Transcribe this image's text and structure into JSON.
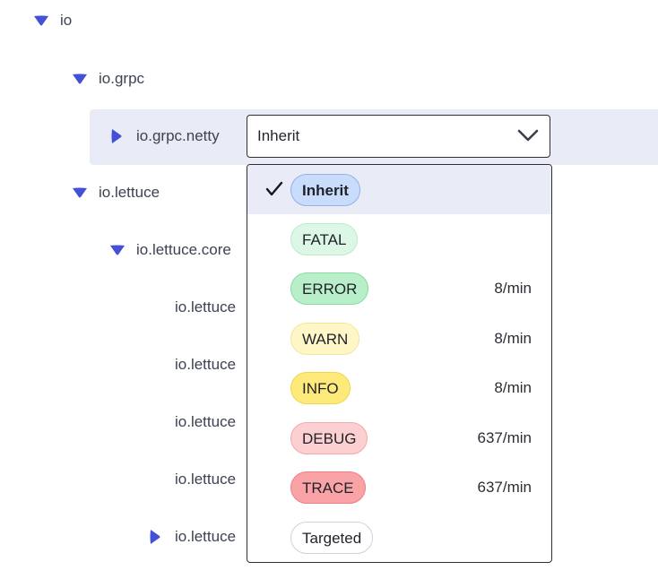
{
  "tree": [
    {
      "label": "io",
      "expander": "expanded-triangle-icon"
    },
    {
      "label": "io.grpc",
      "expander": "expanded-triangle-icon"
    },
    {
      "label": "io.grpc.netty",
      "expander": "collapsed-triangle-icon"
    },
    {
      "label": "io.lettuce",
      "expander": "expanded-triangle-icon"
    },
    {
      "label": "io.lettuce.core",
      "expander": "expanded-triangle-icon"
    },
    {
      "label": "io.lettuce",
      "expander": null
    },
    {
      "label": "io.lettuce",
      "expander": null
    },
    {
      "label": "io.lettuce",
      "expander": null
    },
    {
      "label": "io.lettuce",
      "expander": null
    },
    {
      "label": "io.lettuce",
      "expander": "collapsed-triangle-icon"
    }
  ],
  "level_select": {
    "value": "Inherit",
    "icon": "chevron-down-icon"
  },
  "options": [
    {
      "label": "Inherit",
      "rate": "",
      "selected": true,
      "bg": "#c9dcfb",
      "border": "#8fb2ec"
    },
    {
      "label": "FATAL",
      "rate": "",
      "selected": false,
      "bg": "#dcf7e6",
      "border": "#b9ebc9"
    },
    {
      "label": "ERROR",
      "rate": "8/min",
      "selected": false,
      "bg": "#b8efc8",
      "border": "#86dca0"
    },
    {
      "label": "WARN",
      "rate": "8/min",
      "selected": false,
      "bg": "#fff6c8",
      "border": "#f5e598"
    },
    {
      "label": "INFO",
      "rate": "8/min",
      "selected": false,
      "bg": "#fdea7a",
      "border": "#f1d64a"
    },
    {
      "label": "DEBUG",
      "rate": "637/min",
      "selected": false,
      "bg": "#fccfd0",
      "border": "#f3a9ab"
    },
    {
      "label": "TRACE",
      "rate": "637/min",
      "selected": false,
      "bg": "#f9a3a6",
      "border": "#ec7e82"
    },
    {
      "label": "Targeted",
      "rate": "",
      "selected": false,
      "bg": "#ffffff",
      "border": "#cfd2d8"
    }
  ],
  "colors": {
    "accent": "#4450d6",
    "selected_row_bg": "#e9ecf6"
  }
}
